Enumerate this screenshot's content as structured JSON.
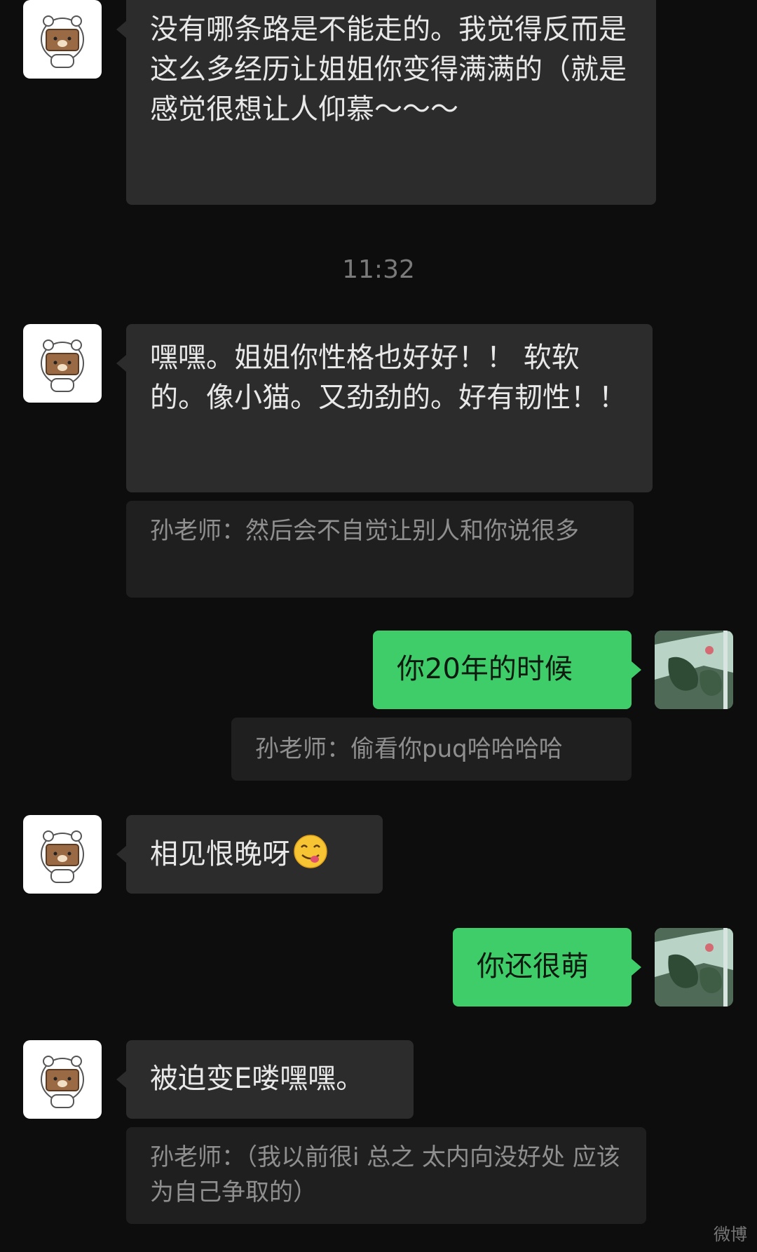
{
  "messages": [
    {
      "id": "m1",
      "side": "in",
      "text": "没有哪条路是不能走的。我觉得反而是这么多经历让姐姐你变得满满的（就是感觉很想让人仰慕～～～"
    },
    {
      "id": "time1",
      "type": "time",
      "text": "11:32"
    },
    {
      "id": "m2",
      "side": "in",
      "text": "嘿嘿。姐姐你性格也好好！！ 软软的。像小猫。又劲劲的。好有韧性！！"
    },
    {
      "id": "q1",
      "type": "quote",
      "text": "孙老师：然后会不自觉让别人和你说很多"
    },
    {
      "id": "m3",
      "side": "out",
      "text": "你20年的时候"
    },
    {
      "id": "q2",
      "type": "quote",
      "text": "孙老师：偷看你puq哈哈哈哈"
    },
    {
      "id": "m4",
      "side": "in",
      "text": "相见恨晚呀",
      "emoji": "yum-face-emoji"
    },
    {
      "id": "m5",
      "side": "out",
      "text": "你还很萌"
    },
    {
      "id": "m6",
      "side": "in",
      "text": "被迫变E喽嘿嘿。"
    },
    {
      "id": "q3",
      "type": "quote",
      "text": "孙老师：（我以前很i 总之 太内向没好处 应该为自己争取的）"
    }
  ],
  "icons": {
    "contact_avatar": "bear-avatar-icon",
    "self_avatar": "flower-photo-avatar-icon"
  },
  "watermark": "微博"
}
